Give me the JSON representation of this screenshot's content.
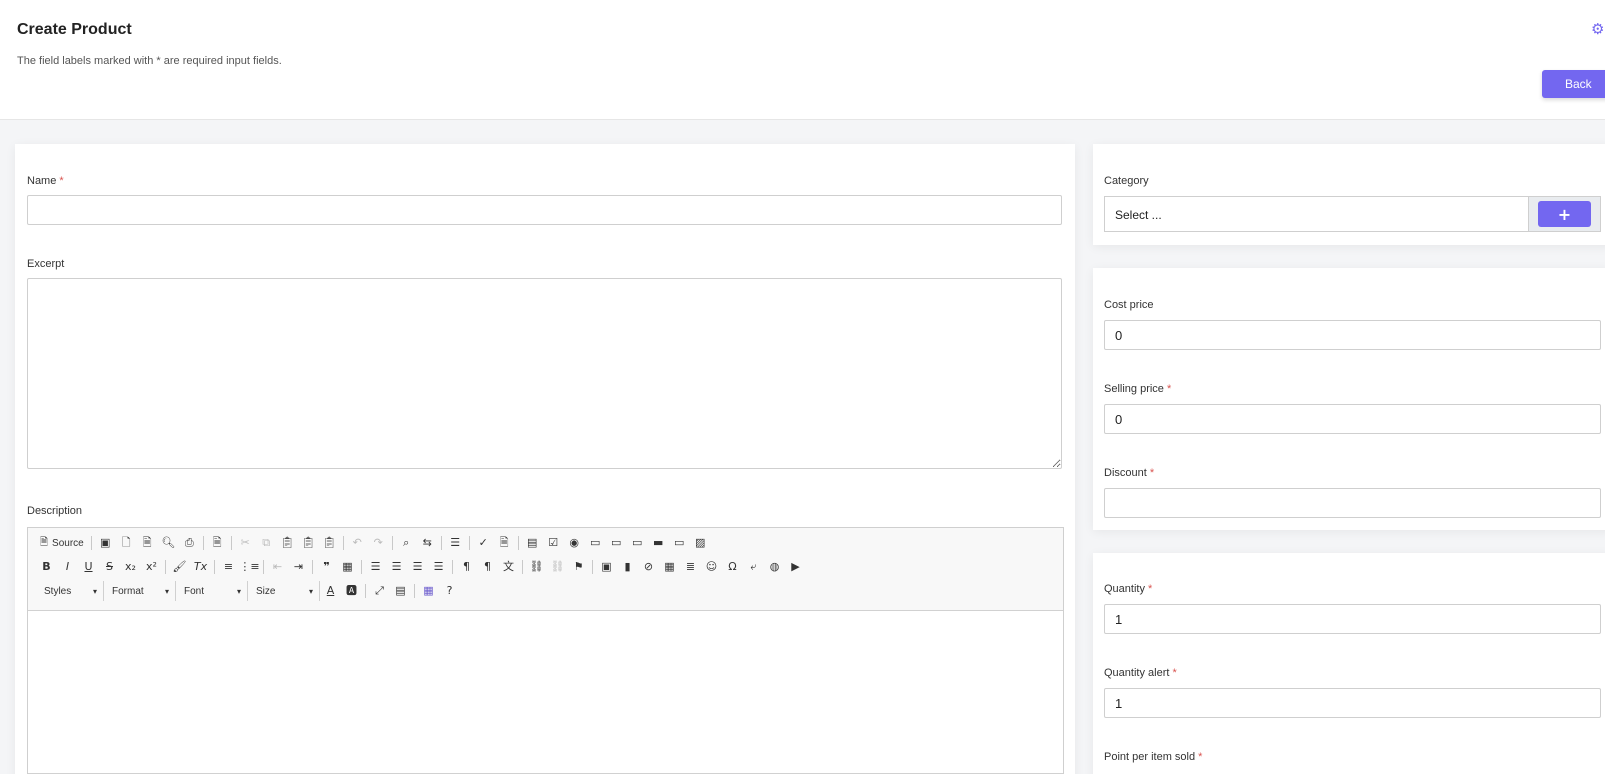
{
  "header": {
    "title": "Create Product",
    "note": "The field labels marked with * are required input fields.",
    "back_label": "Back",
    "accent": "#7367f0"
  },
  "form": {
    "name_label": "Name",
    "name_value": "",
    "excerpt_label": "Excerpt",
    "excerpt_value": "",
    "description_label": "Description",
    "category_label": "Category",
    "category_value": "Select ...",
    "category_add": "+",
    "cost_price_label": "Cost price",
    "cost_price_value": "0",
    "selling_price_label": "Selling price",
    "selling_price_value": "0",
    "discount_label": "Discount",
    "discount_value": "",
    "quantity_label": "Quantity",
    "quantity_value": "1",
    "quantity_alert_label": "Quantity alert",
    "quantity_alert_value": "1",
    "point_per_item_label": "Point per item sold",
    "required_mark": "*"
  },
  "editor": {
    "source_label": "Source",
    "combos": [
      "Styles",
      "Format",
      "Font",
      "Size"
    ]
  }
}
